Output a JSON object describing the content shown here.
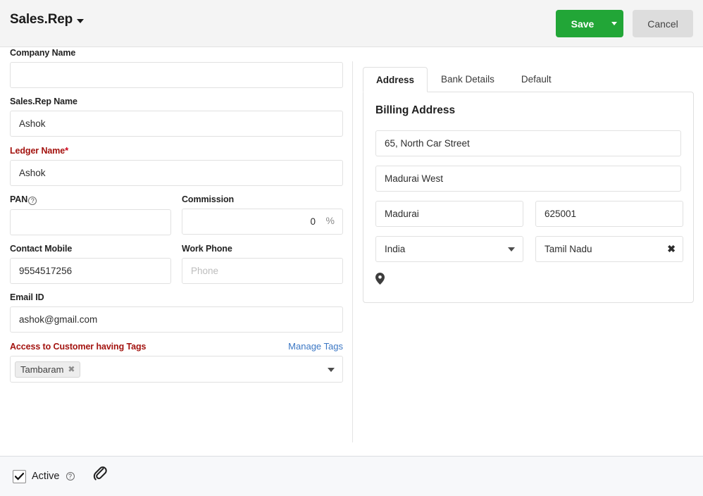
{
  "header": {
    "title": "Sales.Rep",
    "dropdown_icon": "caret-down-icon",
    "save_label": "Save",
    "save_caret_icon": "caret-down-icon",
    "cancel_label": "Cancel",
    "save_color": "#22a637",
    "cancel_color": "#dddddd"
  },
  "form": {
    "company_name": {
      "label": "Company Name",
      "value": "",
      "placeholder": ""
    },
    "sales_rep_name": {
      "label": "Sales.Rep Name",
      "value": "Ashok",
      "placeholder": ""
    },
    "ledger_name": {
      "label": "Ledger Name",
      "required_mark": "*",
      "value": "Ashok",
      "placeholder": "",
      "label_color": "#a3130f"
    },
    "pan": {
      "label": "PAN",
      "help_icon": "help-circle-icon",
      "value": "",
      "placeholder": ""
    },
    "commission": {
      "label": "Commission",
      "value": "0",
      "suffix": "%",
      "placeholder": ""
    },
    "contact_mobile": {
      "label": "Contact Mobile",
      "value": "9554517256",
      "placeholder": ""
    },
    "work_phone": {
      "label": "Work Phone",
      "value": "",
      "placeholder": "Phone"
    },
    "email_id": {
      "label": "Email ID",
      "value": "ashok@gmail.com",
      "placeholder": ""
    },
    "tags": {
      "label": "Access to Customer having Tags",
      "label_color": "#a3130f",
      "manage_link": "Manage Tags",
      "link_color": "#3b77c4",
      "chips": [
        {
          "label": "Tambaram",
          "remove_icon": "close-icon"
        }
      ],
      "dropdown_icon": "caret-down-icon"
    }
  },
  "right_panel": {
    "tabs": [
      {
        "label": "Address",
        "active": true
      },
      {
        "label": "Bank Details",
        "active": false
      },
      {
        "label": "Default",
        "active": false
      }
    ],
    "section_title": "Billing Address",
    "address": {
      "street": "65, North Car Street",
      "area": "Madurai West",
      "city": "Madurai",
      "postal_code": "625001",
      "country": "India",
      "state": "Tamil Nadu",
      "country_dropdown_icon": "caret-down-icon",
      "state_clear_icon": "close-icon",
      "map_pin_icon": "map-pin-icon"
    }
  },
  "footer": {
    "active_label": "Active",
    "active_checked": true,
    "active_help_icon": "help-circle-icon",
    "attachment_icon": "paperclip-icon"
  }
}
